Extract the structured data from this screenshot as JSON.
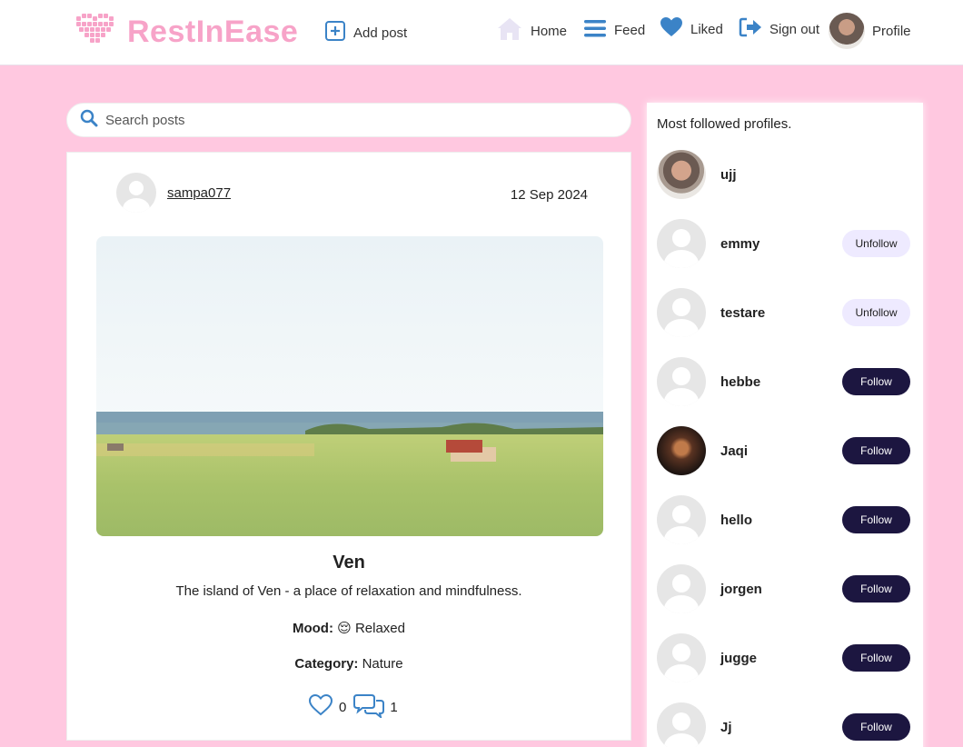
{
  "header": {
    "logo_text": "RestInEase",
    "add_post_label": "Add post",
    "nav": {
      "home": "Home",
      "feed": "Feed",
      "liked": "Liked",
      "sign_out": "Sign out",
      "profile": "Profile"
    }
  },
  "search": {
    "placeholder": "Search posts"
  },
  "post": {
    "author": "sampa077",
    "date": "12 Sep 2024",
    "title": "Ven",
    "description": "The island of Ven - a place of relaxation and mindfulness.",
    "mood_label": "Mood:",
    "mood_emoji": "😌",
    "mood_value": "Relaxed",
    "category_label": "Category:",
    "category_value": "Nature",
    "likes": "0",
    "comments": "1"
  },
  "sidebar": {
    "title": "Most followed profiles.",
    "profiles": [
      {
        "name": "ujj",
        "button": ""
      },
      {
        "name": "emmy",
        "button": "Unfollow"
      },
      {
        "name": "testare",
        "button": "Unfollow"
      },
      {
        "name": "hebbe",
        "button": "Follow"
      },
      {
        "name": "Jaqi",
        "button": "Follow"
      },
      {
        "name": "hello",
        "button": "Follow"
      },
      {
        "name": "jorgen",
        "button": "Follow"
      },
      {
        "name": "jugge",
        "button": "Follow"
      },
      {
        "name": "Jj",
        "button": "Follow"
      }
    ]
  },
  "colors": {
    "page_background": "#ffc8e0",
    "logo_pink": "#f7a3c8",
    "icon_blue": "#3b83c7",
    "follow_button": "#1c1640",
    "unfollow_button": "#eeeaff"
  }
}
